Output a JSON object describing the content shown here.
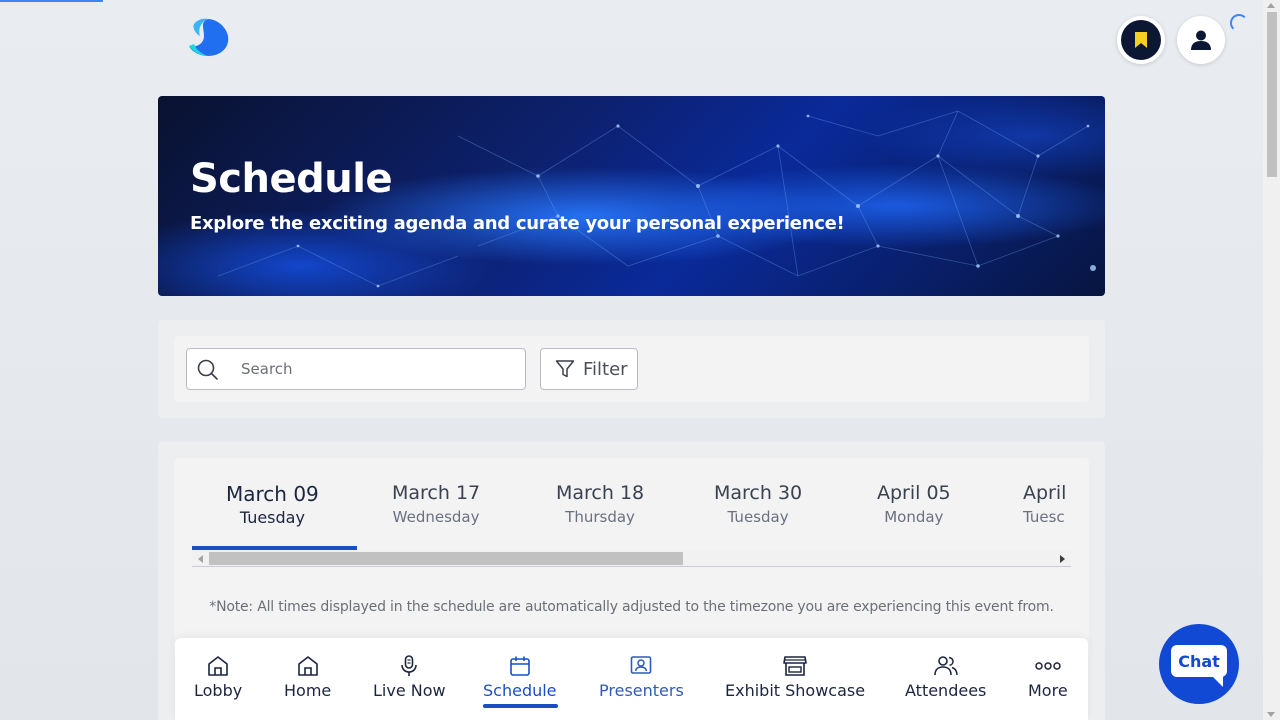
{
  "banner": {
    "title": "Schedule",
    "subtitle": "Explore the exciting agenda and curate your personal experience!"
  },
  "search": {
    "placeholder": "Search",
    "value": ""
  },
  "filter": {
    "label": "Filter"
  },
  "dates": [
    {
      "date": "March 09",
      "weekday": "Tuesday",
      "active": true
    },
    {
      "date": "March 17",
      "weekday": "Wednesday",
      "active": false
    },
    {
      "date": "March 18",
      "weekday": "Thursday",
      "active": false
    },
    {
      "date": "March 30",
      "weekday": "Tuesday",
      "active": false
    },
    {
      "date": "April 05",
      "weekday": "Monday",
      "active": false
    },
    {
      "date": "April",
      "weekday": "Tuesc",
      "active": false
    }
  ],
  "note": "*Note: All times displayed in the schedule are automatically adjusted to the timezone you are experiencing this event from.",
  "nav": [
    {
      "label": "Lobby",
      "icon": "lobby-icon"
    },
    {
      "label": "Home",
      "icon": "home-icon"
    },
    {
      "label": "Live Now",
      "icon": "microphone-icon"
    },
    {
      "label": "Schedule",
      "icon": "calendar-icon",
      "active": true
    },
    {
      "label": "Presenters",
      "icon": "presenter-icon"
    },
    {
      "label": "Exhibit Showcase",
      "icon": "storefront-icon"
    },
    {
      "label": "Attendees",
      "icon": "people-icon"
    },
    {
      "label": "More",
      "icon": "more-dots-icon"
    }
  ],
  "chat": {
    "label": "Chat"
  },
  "colors": {
    "accent": "#1a4fc4",
    "chat": "#1148d4",
    "bookmark_bg": "#0c1733",
    "bookmark_icon": "#f5d020"
  }
}
